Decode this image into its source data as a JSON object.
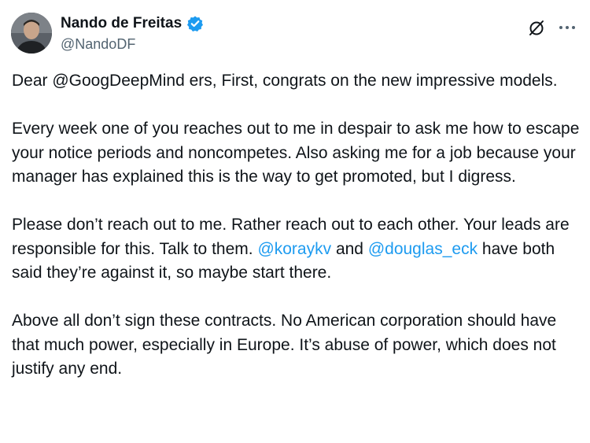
{
  "author": {
    "display_name": "Nando de Freitas",
    "handle": "@NandoDF",
    "verified": true,
    "verified_color": "#1d9bf0"
  },
  "icons": {
    "grok": "grok-icon",
    "more": "more-horizontal-icon",
    "verified": "verified-badge-icon"
  },
  "tweet": {
    "p1": "Dear @GoogDeepMind ers, First, congrats on the new impressive models.",
    "p2": "Every week one of you reaches out to me in despair to ask me how to escape your notice periods and noncompetes. Also asking me for a job because your manager has explained this is the way to get promoted, but I digress.",
    "p3_a": "Please don’t reach out to me. Rather reach out to each other. Your leads are responsible for this. Talk to them. ",
    "p3_mention1": "@koraykv",
    "p3_b": " and ",
    "p3_mention2": "@douglas_eck",
    "p3_c": " have both said they’re against it, so maybe start there.",
    "p4": "Above all don’t sign these contracts. No American corporation should have that much power, especially in Europe. It’s abuse of power, which does not justify any end."
  },
  "colors": {
    "text": "#0f1419",
    "secondary": "#536471",
    "link": "#1d9bf0"
  }
}
